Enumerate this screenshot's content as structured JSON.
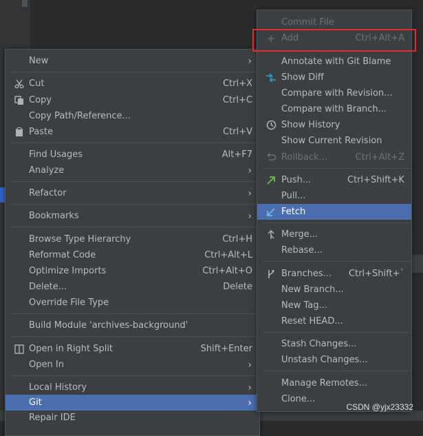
{
  "main_menu": {
    "items": [
      {
        "label": "New",
        "shortcut": "",
        "arrow": true,
        "icon": ""
      },
      {
        "label": "Cut",
        "shortcut": "Ctrl+X",
        "arrow": false,
        "icon": "scissors-icon"
      },
      {
        "label": "Copy",
        "shortcut": "Ctrl+C",
        "arrow": false,
        "icon": "copy-icon"
      },
      {
        "label": "Copy Path/Reference...",
        "shortcut": "",
        "arrow": false,
        "icon": ""
      },
      {
        "label": "Paste",
        "shortcut": "Ctrl+V",
        "arrow": false,
        "icon": "paste-icon"
      },
      {
        "label": "Find Usages",
        "shortcut": "Alt+F7",
        "arrow": false,
        "icon": ""
      },
      {
        "label": "Analyze",
        "shortcut": "",
        "arrow": true,
        "icon": ""
      },
      {
        "label": "Refactor",
        "shortcut": "",
        "arrow": true,
        "icon": ""
      },
      {
        "label": "Bookmarks",
        "shortcut": "",
        "arrow": true,
        "icon": ""
      },
      {
        "label": "Browse Type Hierarchy",
        "shortcut": "Ctrl+H",
        "arrow": false,
        "icon": ""
      },
      {
        "label": "Reformat Code",
        "shortcut": "Ctrl+Alt+L",
        "arrow": false,
        "icon": ""
      },
      {
        "label": "Optimize Imports",
        "shortcut": "Ctrl+Alt+O",
        "arrow": false,
        "icon": ""
      },
      {
        "label": "Delete...",
        "shortcut": "Delete",
        "arrow": false,
        "icon": ""
      },
      {
        "label": "Override File Type",
        "shortcut": "",
        "arrow": false,
        "icon": ""
      },
      {
        "label": "Build Module 'archives-background'",
        "shortcut": "",
        "arrow": false,
        "icon": ""
      },
      {
        "label": "Open in Right Split",
        "shortcut": "Shift+Enter",
        "arrow": false,
        "icon": "split-icon"
      },
      {
        "label": "Open In",
        "shortcut": "",
        "arrow": true,
        "icon": ""
      },
      {
        "label": "Local History",
        "shortcut": "",
        "arrow": true,
        "icon": ""
      },
      {
        "label": "Git",
        "shortcut": "",
        "arrow": true,
        "icon": "",
        "selected": true
      },
      {
        "label": "Repair IDE",
        "shortcut": "",
        "arrow": false,
        "icon": ""
      }
    ]
  },
  "git_menu": {
    "items": [
      {
        "label": "Commit File",
        "shortcut": "",
        "icon": "",
        "disabled": true
      },
      {
        "label": "Add",
        "shortcut": "Ctrl+Alt+A",
        "icon": "plus-icon",
        "disabled": true
      },
      {
        "label": "Annotate with Git Blame",
        "shortcut": "",
        "icon": ""
      },
      {
        "label": "Show Diff",
        "shortcut": "",
        "icon": "diff-icon"
      },
      {
        "label": "Compare with Revision...",
        "shortcut": "",
        "icon": ""
      },
      {
        "label": "Compare with Branch...",
        "shortcut": "",
        "icon": ""
      },
      {
        "label": "Show History",
        "shortcut": "",
        "icon": "clock-icon"
      },
      {
        "label": "Show Current Revision",
        "shortcut": "",
        "icon": ""
      },
      {
        "label": "Rollback...",
        "shortcut": "Ctrl+Alt+Z",
        "icon": "rollback-icon",
        "disabled": true
      },
      {
        "label": "Push...",
        "shortcut": "Ctrl+Shift+K",
        "icon": "push-arrow-icon"
      },
      {
        "label": "Pull...",
        "shortcut": "",
        "icon": ""
      },
      {
        "label": "Fetch",
        "shortcut": "",
        "icon": "fetch-icon",
        "selected": true
      },
      {
        "label": "Merge...",
        "shortcut": "",
        "icon": "merge-icon"
      },
      {
        "label": "Rebase...",
        "shortcut": "",
        "icon": ""
      },
      {
        "label": "Branches...",
        "shortcut": "Ctrl+Shift+`",
        "icon": "branch-icon"
      },
      {
        "label": "New Branch...",
        "shortcut": "",
        "icon": ""
      },
      {
        "label": "New Tag...",
        "shortcut": "",
        "icon": ""
      },
      {
        "label": "Reset HEAD...",
        "shortcut": "",
        "icon": ""
      },
      {
        "label": "Stash Changes...",
        "shortcut": "",
        "icon": ""
      },
      {
        "label": "Unstash Changes...",
        "shortcut": "",
        "icon": ""
      },
      {
        "label": "Manage Remotes...",
        "shortcut": "",
        "icon": ""
      },
      {
        "label": "Clone...",
        "shortcut": "",
        "icon": ""
      }
    ]
  },
  "watermark": "CSDN @yjx23332",
  "colors": {
    "menu_bg": "#3c3f41",
    "selection": "#4b6eaf",
    "highlight_box": "#e52b2b",
    "text": "#bbbbbb",
    "disabled_text": "#737373"
  }
}
